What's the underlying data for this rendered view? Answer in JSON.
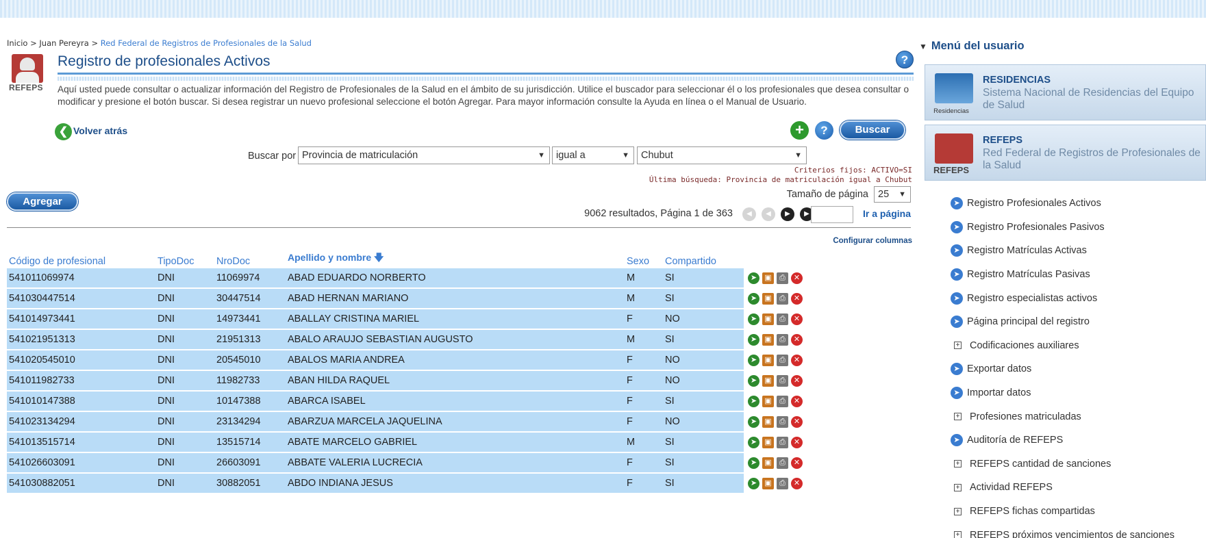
{
  "breadcrumb": {
    "home": "Inicio",
    "sep1": " > ",
    "user": "Juan Pereyra",
    "sep2": " > ",
    "current": "Red Federal de Registros de Profesionales de la Salud"
  },
  "page": {
    "title": "Registro de profesionales Activos",
    "logo_label": "REFEPS",
    "description": "Aquí usted puede consultar o actualizar información del Registro de Profesionales de la Salud en el ámbito de su jurisdicción. Utilice el buscador para seleccionar él o los profesionales que desea consultar o modificar y presione el botón buscar. Si desea registrar un nuevo profesional seleccione el botón Agregar. Para mayor información consulte la Ayuda en línea o el Manual de Usuario.",
    "back_label": "Volver atrás",
    "help_label": "?"
  },
  "toolbar": {
    "search_button": "Buscar",
    "add_button": "Agregar",
    "add_icon": "+",
    "help_icon": "?"
  },
  "search": {
    "label": "Buscar por",
    "field": "Provincia de matriculación",
    "operator": "igual a",
    "value": "Chubut",
    "criteria_fixed": "Criterios fijos: ACTIVO=SI",
    "last_search": "Última búsqueda: Provincia de matriculación igual a Chubut"
  },
  "pagination": {
    "page_size_label": "Tamaño de página",
    "page_size": "25",
    "summary": "9062  resultados, Página 1 de 363",
    "goto_label": "Ir a página",
    "page_input": ""
  },
  "table": {
    "configure_label": "Configurar columnas",
    "headers": {
      "code": "Código de profesional",
      "doc_type": "TipoDoc",
      "doc_num": "NroDoc",
      "name": "Apellido y nombre",
      "sex": "Sexo",
      "shared": "Compartido"
    },
    "rows": [
      {
        "code": "541011069974",
        "doc_type": "DNI",
        "doc_num": "11069974",
        "name": "ABAD EDUARDO NORBERTO",
        "sex": "M",
        "shared": "SI"
      },
      {
        "code": "541030447514",
        "doc_type": "DNI",
        "doc_num": "30447514",
        "name": "ABAD HERNAN MARIANO",
        "sex": "M",
        "shared": "SI"
      },
      {
        "code": "541014973441",
        "doc_type": "DNI",
        "doc_num": "14973441",
        "name": "ABALLAY CRISTINA MARIEL",
        "sex": "F",
        "shared": "NO"
      },
      {
        "code": "541021951313",
        "doc_type": "DNI",
        "doc_num": "21951313",
        "name": "ABALO ARAUJO SEBASTIAN AUGUSTO",
        "sex": "M",
        "shared": "SI"
      },
      {
        "code": "541020545010",
        "doc_type": "DNI",
        "doc_num": "20545010",
        "name": "ABALOS MARIA ANDREA",
        "sex": "F",
        "shared": "NO"
      },
      {
        "code": "541011982733",
        "doc_type": "DNI",
        "doc_num": "11982733",
        "name": "ABAN HILDA RAQUEL",
        "sex": "F",
        "shared": "NO"
      },
      {
        "code": "541010147388",
        "doc_type": "DNI",
        "doc_num": "10147388",
        "name": "ABARCA ISABEL",
        "sex": "F",
        "shared": "SI"
      },
      {
        "code": "541023134294",
        "doc_type": "DNI",
        "doc_num": "23134294",
        "name": "ABARZUA MARCELA JAQUELINA",
        "sex": "F",
        "shared": "NO"
      },
      {
        "code": "541013515714",
        "doc_type": "DNI",
        "doc_num": "13515714",
        "name": "ABATE MARCELO GABRIEL",
        "sex": "M",
        "shared": "SI"
      },
      {
        "code": "541026603091",
        "doc_type": "DNI",
        "doc_num": "26603091",
        "name": "ABBATE VALERIA LUCRECIA",
        "sex": "F",
        "shared": "SI"
      },
      {
        "code": "541030882051",
        "doc_type": "DNI",
        "doc_num": "30882051",
        "name": "ABDO INDIANA JESUS",
        "sex": "F",
        "shared": "SI"
      }
    ]
  },
  "sidebar": {
    "title": "Menú del usuario",
    "apps": [
      {
        "name": "RESIDENCIAS",
        "desc": "Sistema Nacional de Residencias del Equipo de Salud",
        "icon_label": "Residencias"
      },
      {
        "name": "REFEPS",
        "desc": "Red Federal de Registros de Profesionales de la Salud",
        "icon_label": "REFEPS"
      }
    ],
    "items": [
      {
        "label": "Registro Profesionales Activos"
      },
      {
        "label": "Registro Profesionales Pasivos"
      },
      {
        "label": "Registro Matrículas Activas"
      },
      {
        "label": "Registro Matrículas Pasivas"
      },
      {
        "label": "Registro especialistas activos"
      },
      {
        "label": "Página principal del registro"
      },
      {
        "label": "Codificaciones auxiliares"
      },
      {
        "label": "Exportar datos"
      },
      {
        "label": "Importar datos"
      },
      {
        "label": "Profesiones matriculadas"
      },
      {
        "label": "Auditoría de REFEPS"
      },
      {
        "label": "REFEPS cantidad de sanciones"
      },
      {
        "label": "Actividad REFEPS"
      },
      {
        "label": "REFEPS fichas compartidas"
      },
      {
        "label": "REFEPS próximos vencimientos de sanciones"
      }
    ]
  },
  "colors": {
    "accent": "#1d4e89",
    "link": "#3a7cd0",
    "row_bg": "#b9dcf7",
    "brand_red": "#b53a36"
  }
}
